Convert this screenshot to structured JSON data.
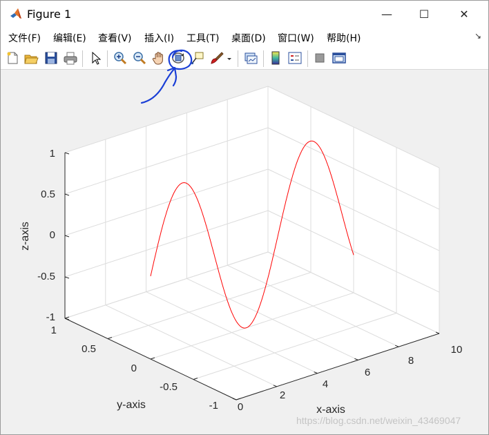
{
  "window": {
    "title": "Figure 1",
    "minimize_glyph": "—",
    "maximize_glyph": "☐",
    "close_glyph": "✕"
  },
  "menu": {
    "items": [
      "文件(F)",
      "编辑(E)",
      "查看(V)",
      "插入(I)",
      "工具(T)",
      "桌面(D)",
      "窗口(W)",
      "帮助(H)"
    ],
    "overflow_glyph": "↘"
  },
  "toolbar": {
    "buttons": [
      {
        "icon": "new-figure-icon"
      },
      {
        "icon": "open-file-icon"
      },
      {
        "icon": "save-icon"
      },
      {
        "icon": "print-icon"
      },
      {
        "icon": "edit-plot-cursor-icon"
      },
      {
        "icon": "zoom-in-icon"
      },
      {
        "icon": "zoom-out-icon"
      },
      {
        "icon": "pan-hand-icon"
      },
      {
        "icon": "rotate-3d-icon"
      },
      {
        "icon": "data-cursor-icon"
      },
      {
        "icon": "brush-icon"
      },
      {
        "icon": "link-plot-icon"
      },
      {
        "icon": "colorbar-icon"
      },
      {
        "icon": "legend-icon"
      },
      {
        "icon": "hide-plot-tools-icon"
      },
      {
        "icon": "show-plot-tools-icon"
      }
    ],
    "highlighted": "rotate-3d-icon"
  },
  "chart_data": {
    "type": "line",
    "projection": "3d",
    "series": [
      {
        "color": "#ff0000",
        "x": "0 to 10",
        "y": 0,
        "z": "sin(x)"
      }
    ],
    "xlabel": "x-axis",
    "ylabel": "y-axis",
    "zlabel": "z-axis",
    "xlim": [
      0,
      10
    ],
    "ylim": [
      -1,
      1
    ],
    "zlim": [
      -1,
      1
    ],
    "xticks": [
      "0",
      "2",
      "4",
      "6",
      "8",
      "10"
    ],
    "yticks": [
      "-1",
      "-0.5",
      "0",
      "0.5",
      "1"
    ],
    "zticks": [
      "-1",
      "-0.5",
      "0",
      "0.5",
      "1"
    ],
    "grid": true
  },
  "watermark": "https://blog.csdn.net/weixin_43469047",
  "colors": {
    "line": "#ff0000",
    "annotation": "#1a3fd6",
    "grid": "#dcdcdc",
    "background": "#f0f0f0"
  }
}
